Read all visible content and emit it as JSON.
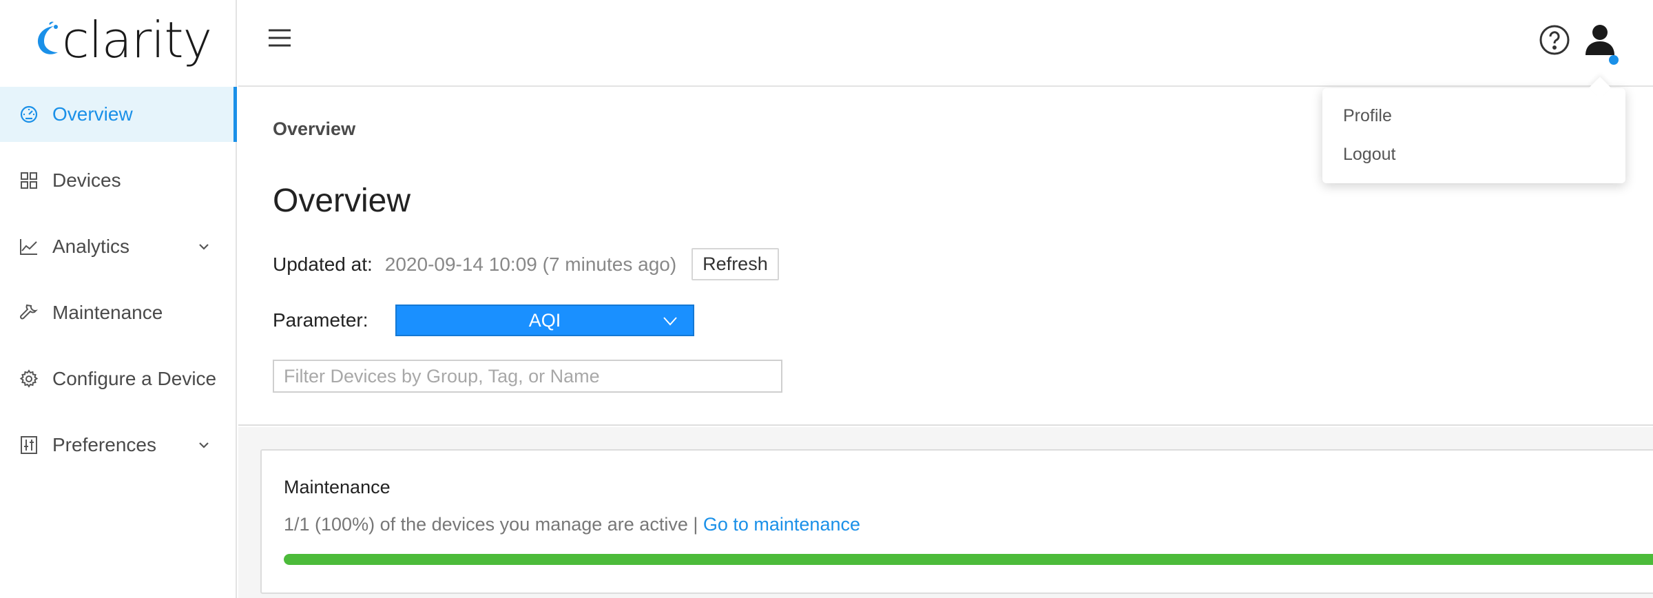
{
  "app": {
    "logo_text": "clarity"
  },
  "colors": {
    "accent": "#1a90e8",
    "select_bg": "#1a90ff",
    "progress": "#4cbb3a"
  },
  "sidebar": {
    "items": [
      {
        "label": "Overview",
        "icon": "dashboard-icon",
        "active": true,
        "expandable": false
      },
      {
        "label": "Devices",
        "icon": "grid-icon",
        "active": false,
        "expandable": false
      },
      {
        "label": "Analytics",
        "icon": "line-chart-icon",
        "active": false,
        "expandable": true
      },
      {
        "label": "Maintenance",
        "icon": "wrench-icon",
        "active": false,
        "expandable": false
      },
      {
        "label": "Configure a Device",
        "icon": "gear-icon",
        "active": false,
        "expandable": false
      },
      {
        "label": "Preferences",
        "icon": "sliders-icon",
        "active": false,
        "expandable": true
      }
    ]
  },
  "topbar": {
    "icons": [
      "menu-icon",
      "help-icon",
      "user-icon"
    ]
  },
  "user_menu": {
    "items": [
      "Profile",
      "Logout"
    ]
  },
  "header": {
    "breadcrumb": "Overview",
    "title": "Overview",
    "updated_label": "Updated at:",
    "updated_value": "2020-09-14 10:09 (7 minutes ago)",
    "refresh_label": "Refresh",
    "parameter_label": "Parameter:",
    "parameter_value": "AQI",
    "filter_placeholder": "Filter Devices by Group, Tag, or Name",
    "filter_value": ""
  },
  "maintenance_card": {
    "title": "Maintenance",
    "text": "1/1 (100%) of the devices you manage are active | ",
    "link": "Go to maintenance",
    "progress": 1.0
  }
}
